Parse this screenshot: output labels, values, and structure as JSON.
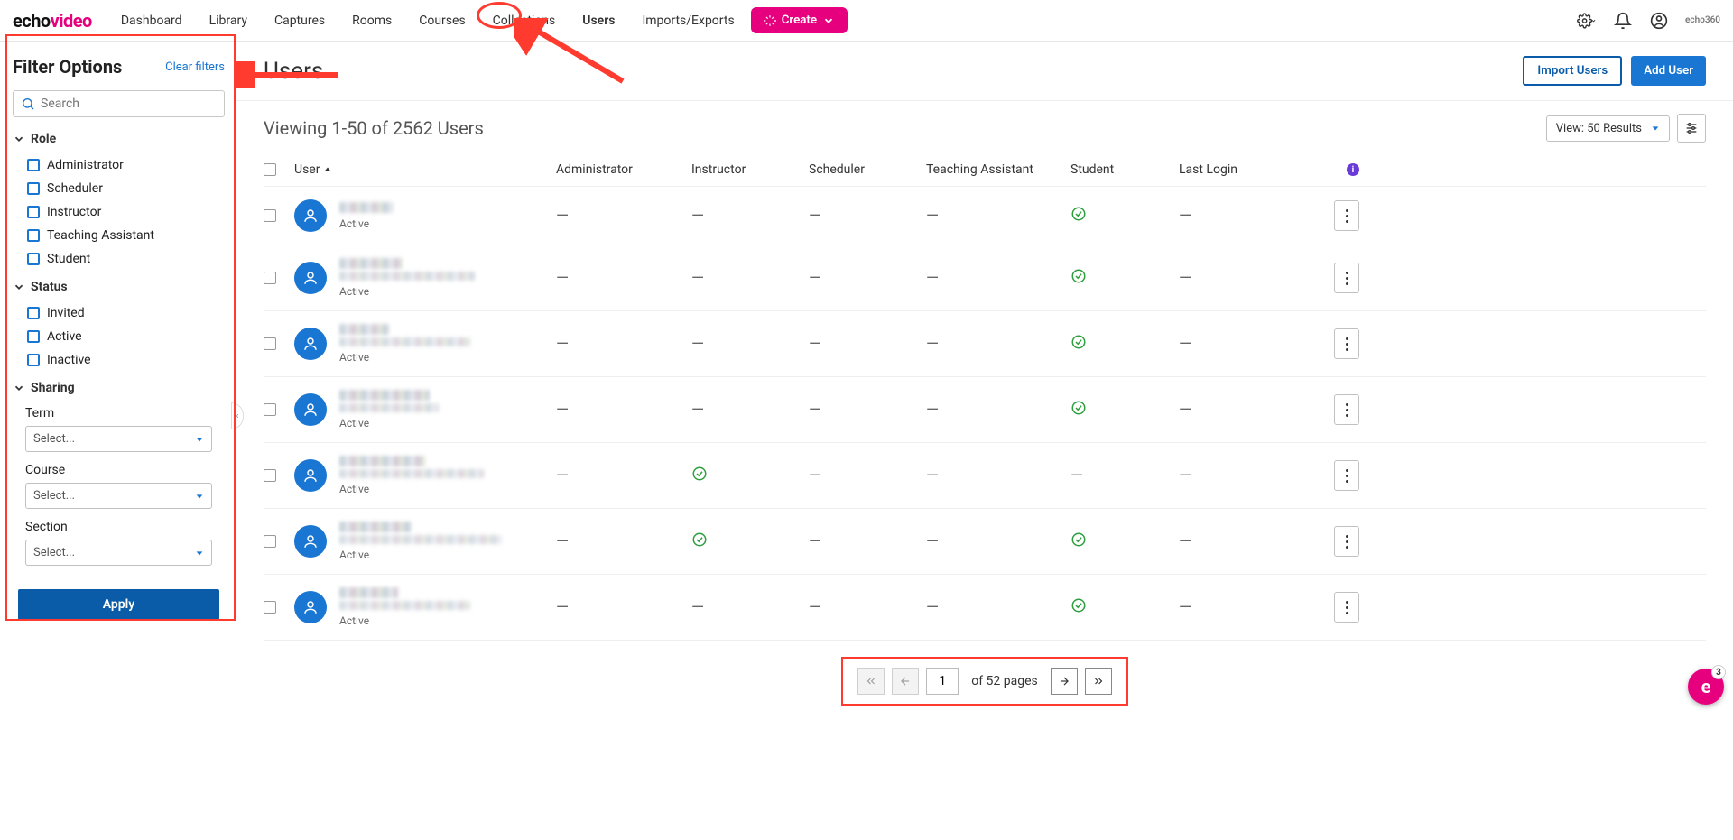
{
  "brand": {
    "part1": "echo",
    "part2": "video",
    "tag": "echo360"
  },
  "nav": {
    "items": [
      "Dashboard",
      "Library",
      "Captures",
      "Rooms",
      "Courses",
      "Collections",
      "Users",
      "Imports/Exports"
    ],
    "active_index": 6,
    "create": "Create"
  },
  "sidebar": {
    "title": "Filter Options",
    "clear": "Clear filters",
    "search_placeholder": "Search",
    "groups": {
      "role": {
        "label": "Role",
        "items": [
          "Administrator",
          "Scheduler",
          "Instructor",
          "Teaching Assistant",
          "Student"
        ]
      },
      "status": {
        "label": "Status",
        "items": [
          "Invited",
          "Active",
          "Inactive"
        ]
      },
      "sharing": {
        "label": "Sharing",
        "term_label": "Term",
        "course_label": "Course",
        "section_label": "Section",
        "select_placeholder": "Select..."
      }
    },
    "apply": "Apply"
  },
  "page": {
    "title": "Users",
    "import_btn": "Import Users",
    "add_btn": "Add User",
    "viewing": "Viewing 1-50 of 2562 Users",
    "view_select": "View: 50 Results"
  },
  "table": {
    "columns": [
      "User",
      "Administrator",
      "Instructor",
      "Scheduler",
      "Teaching Assistant",
      "Student",
      "Last Login"
    ],
    "status_active": "Active",
    "rows": [
      {
        "name_w": 60,
        "email_w": 0,
        "admin": false,
        "instructor": false,
        "scheduler": false,
        "ta": false,
        "student": true,
        "last": ""
      },
      {
        "name_w": 70,
        "email_w": 150,
        "admin": false,
        "instructor": false,
        "scheduler": false,
        "ta": false,
        "student": true,
        "last": ""
      },
      {
        "name_w": 55,
        "email_w": 145,
        "admin": false,
        "instructor": false,
        "scheduler": false,
        "ta": false,
        "student": true,
        "last": ""
      },
      {
        "name_w": 100,
        "email_w": 110,
        "admin": false,
        "instructor": false,
        "scheduler": false,
        "ta": false,
        "student": true,
        "last": ""
      },
      {
        "name_w": 95,
        "email_w": 160,
        "admin": false,
        "instructor": true,
        "scheduler": false,
        "ta": false,
        "student": false,
        "last": ""
      },
      {
        "name_w": 80,
        "email_w": 180,
        "admin": false,
        "instructor": true,
        "scheduler": false,
        "ta": false,
        "student": true,
        "last": ""
      },
      {
        "name_w": 65,
        "email_w": 145,
        "admin": false,
        "instructor": false,
        "scheduler": false,
        "ta": false,
        "student": true,
        "last": ""
      }
    ]
  },
  "pager": {
    "current": "1",
    "total_text": "of 52 pages"
  },
  "float_badge": {
    "letter": "e",
    "count": "3"
  }
}
